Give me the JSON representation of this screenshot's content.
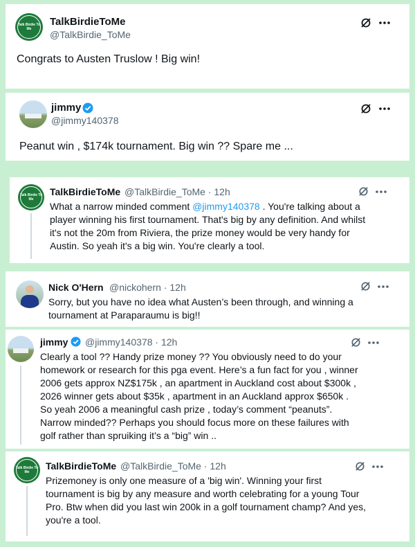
{
  "tweets": [
    {
      "name": "TalkBirdieToMe",
      "handle": "@TalkBirdie_ToMe",
      "avatar_text": "Talk Birdie To Me",
      "lines": [
        "Congrats to Austen Truslow ! Big win!"
      ]
    },
    {
      "name": "jimmy",
      "handle": "@jimmy140378",
      "lines": [
        "Peanut win , $174k  tournament. Big win ?? Spare me ..."
      ]
    },
    {
      "name": "TalkBirdieToMe",
      "handle": "@TalkBirdie_ToMe",
      "time": "12h",
      "avatar_text": "Talk Birdie To Me",
      "line1_pre": "What a narrow minded comment ",
      "mention": "@jimmy140378",
      "line1_post": " . You're talking about a",
      "lines": [
        "player winning his first tournament. That's big by any definition. And whilst",
        "it's not the 20m from Riviera, the prize money would be very handy for",
        "Austin. So yeah it's a big win. You're clearly a tool."
      ]
    },
    {
      "name": "Nick O'Hern",
      "handle": "@nickohern",
      "time": "12h",
      "lines": [
        "Sorry, but you have no idea what Austen’s been through, and winning a",
        "tournament at Paraparaumu is big!!"
      ]
    },
    {
      "name": "jimmy",
      "handle": "@jimmy140378",
      "time": "12h",
      "lines": [
        "Clearly a tool ?? Handy prize money ?? You obviously need to do your",
        "homework or research for this pga event. Here’s a fun fact for you , winner",
        "2006 gets approx NZ$175k , an apartment in Auckland cost about $300k ,",
        "2026 winner gets about $35k , apartment in an Auckland approx $650k .",
        "So yeah 2006 a meaningful cash prize , today’s comment “peanuts”.",
        "Narrow minded?? Perhaps you should focus more on these failures with",
        "golf rather than spruiking it’s a “big” win .."
      ]
    },
    {
      "name": "TalkBirdieToMe",
      "handle": "@TalkBirdie_ToMe",
      "time": "12h",
      "avatar_text": "Talk Birdie To Me",
      "lines": [
        "Prizemoney is only one measure of a 'big win'. Winning your first",
        "tournament is big by any measure and worth celebrating for a young Tour",
        "Pro. Btw when did you last win 200k in a golf tournament champ? And yes,",
        "you're a tool."
      ]
    }
  ],
  "separator": " · ",
  "more_icon": "more-dots-icon",
  "grok_icon": "slashed-circle-icon",
  "verified_icon": "verified-badge-icon",
  "colors": {
    "background": "#c9efd2",
    "mention": "#1d9bf0",
    "verified": "#1d9bf0",
    "secondary": "#536471"
  }
}
